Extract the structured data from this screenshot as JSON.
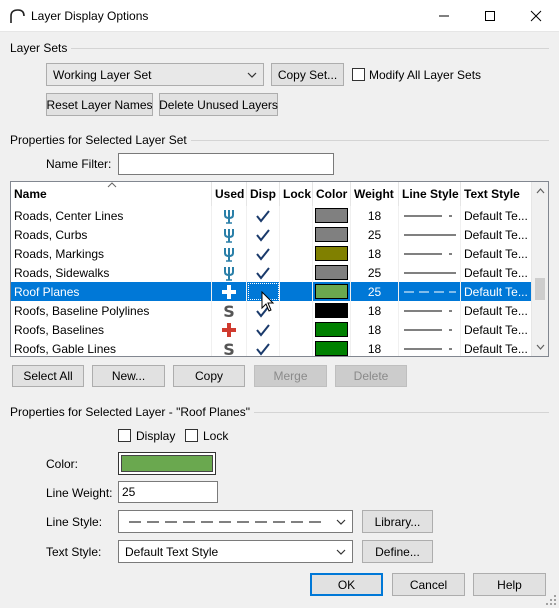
{
  "window": {
    "title": "Layer Display Options",
    "minimize": "—",
    "maximize": "☐",
    "close": "✕"
  },
  "layer_sets": {
    "group_label": "Layer Sets",
    "selected": "Working Layer Set",
    "copy_set": "Copy Set...",
    "modify_all": "Modify All Layer Sets",
    "reset_names": "Reset Layer Names",
    "delete_unused": "Delete Unused Layers"
  },
  "properties_set": {
    "group_label": "Properties for Selected Layer Set",
    "name_filter_label": "Name Filter:",
    "name_filter_value": ""
  },
  "table": {
    "columns": [
      "Name",
      "Used",
      "Disp",
      "Lock",
      "Color",
      "Weight",
      "Line Style",
      "Text Style"
    ],
    "rows": [
      {
        "name": "Roads, Center Lines",
        "used": "road",
        "disp": true,
        "color": "#808080",
        "weight": "18",
        "line": "solid-dot",
        "text": "Default Te..."
      },
      {
        "name": "Roads, Curbs",
        "used": "road",
        "disp": true,
        "color": "#808080",
        "weight": "25",
        "line": "solid",
        "text": "Default Te..."
      },
      {
        "name": "Roads, Markings",
        "used": "road",
        "disp": true,
        "color": "#808000",
        "weight": "18",
        "line": "solid-dot",
        "text": "Default Te..."
      },
      {
        "name": "Roads, Sidewalks",
        "used": "road",
        "disp": true,
        "color": "#808080",
        "weight": "25",
        "line": "solid",
        "text": "Default Te..."
      },
      {
        "name": "Roof Planes",
        "used": "plus-white",
        "disp": false,
        "color": "#6aa84f",
        "weight": "25",
        "line": "dashed",
        "text": "Default Te...",
        "selected": true
      },
      {
        "name": "Roofs, Baseline Polylines",
        "used": "s",
        "disp": true,
        "color": "#000000",
        "weight": "18",
        "line": "solid-dot",
        "text": "Default Te..."
      },
      {
        "name": "Roofs, Baselines",
        "used": "plus-red",
        "disp": true,
        "color": "#008000",
        "weight": "18",
        "line": "solid-dot",
        "text": "Default Te..."
      },
      {
        "name": "Roofs, Gable Lines",
        "used": "s",
        "disp": true,
        "color": "#008000",
        "weight": "18",
        "line": "solid-dot",
        "text": "Default Te..."
      }
    ]
  },
  "list_buttons": {
    "select_all": "Select All",
    "new": "New...",
    "copy": "Copy",
    "merge": "Merge",
    "delete": "Delete"
  },
  "layer_props": {
    "group_label": "Properties for Selected Layer - \"Roof Planes\"",
    "display_label": "Display",
    "lock_label": "Lock",
    "color_label": "Color:",
    "color_value": "#6aa84f",
    "weight_label": "Line Weight:",
    "weight_value": "25",
    "line_style_label": "Line Style:",
    "library": "Library...",
    "text_style_label": "Text Style:",
    "text_style_value": "Default Text Style",
    "define": "Define..."
  },
  "footer": {
    "ok": "OK",
    "cancel": "Cancel",
    "help": "Help"
  }
}
